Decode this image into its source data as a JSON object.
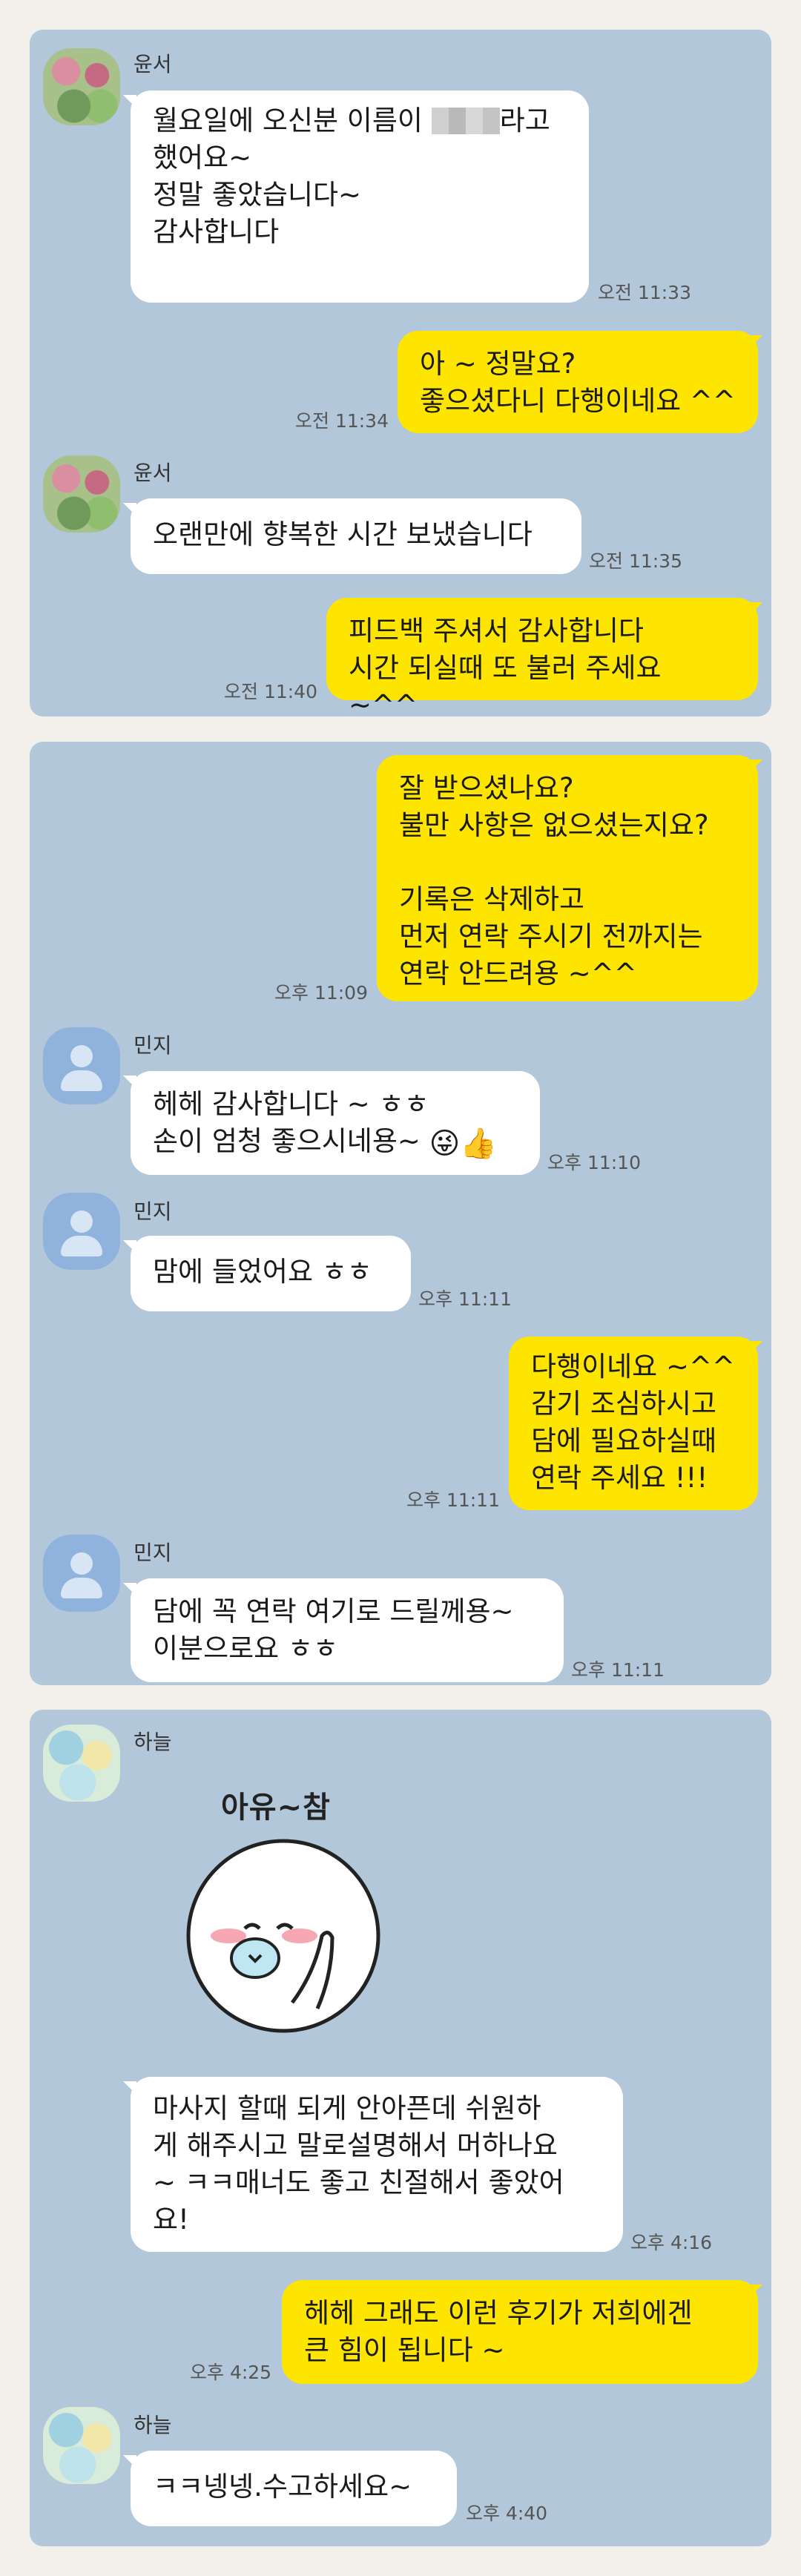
{
  "panel1": {
    "m1": {
      "name": "윤서",
      "lines": [
        "월요일에 오신분 이름이 ",
        "라고\n했어요~\n정말 좋았습니다~\n감사합니다"
      ],
      "time": "오전 11:33"
    },
    "m2": {
      "text": "아 ~ 정말요?\n좋으셨다니 다행이네요 ^^",
      "time": "오전 11:34"
    },
    "m3": {
      "name": "윤서",
      "text": "오랜만에 향복한 시간 보냈습니다",
      "time": "오전 11:35"
    },
    "m4": {
      "text": "피드백 주셔서 감사합니다\n시간 되실때 또 불러 주세요 ~^^",
      "time": "오전 11:40"
    }
  },
  "panel2": {
    "m1": {
      "text": "잘 받으셨나요?\n불만 사항은 없으셨는지요?\n\n기록은 삭제하고\n먼저 연락 주시기 전까지는\n연락 안드려용 ~^^",
      "time": "오후 11:09"
    },
    "m2": {
      "name": "민지",
      "text": "헤헤 감사합니다 ~ ㅎㅎ\n손이 엄청 좋으시네용~ ",
      "emoji": "😜👍",
      "time": "오후 11:10"
    },
    "m3": {
      "name": "민지",
      "text": "맘에 들었어요 ㅎㅎ",
      "time": "오후 11:11"
    },
    "m4": {
      "text": "다행이네요 ~^^\n감기 조심하시고\n담에 필요하실때\n연락 주세요 !!!",
      "time": "오후 11:11"
    },
    "m5": {
      "name": "민지",
      "text": "담에 꼭 연락 여기로 드릴께용~\n이분으로요 ㅎㅎ",
      "time": "오후 11:11"
    }
  },
  "panel3": {
    "m1": {
      "name": "하늘",
      "sticker_text": "아유~참",
      "text": "마사지 할때 되게 안아픈데 쉬원하\n게 해주시고 말로설명해서 머하나요\n~ ㅋㅋ매너도 좋고 친절해서 좋았어\n요!",
      "time": "오후 4:16"
    },
    "m2": {
      "text": "헤헤 그래도 이런 후기가 저희에겐\n큰 힘이 됩니다 ~",
      "time": "오후 4:25"
    },
    "m3": {
      "name": "하늘",
      "text": "ㅋㅋ넹넹.수고하세요~",
      "time": "오후 4:40"
    }
  },
  "colors": {
    "panel_bg": "#b2c7d9",
    "my_bubble": "#fee500",
    "other_bubble": "#ffffff",
    "page_bg": "#f3f0ec"
  }
}
